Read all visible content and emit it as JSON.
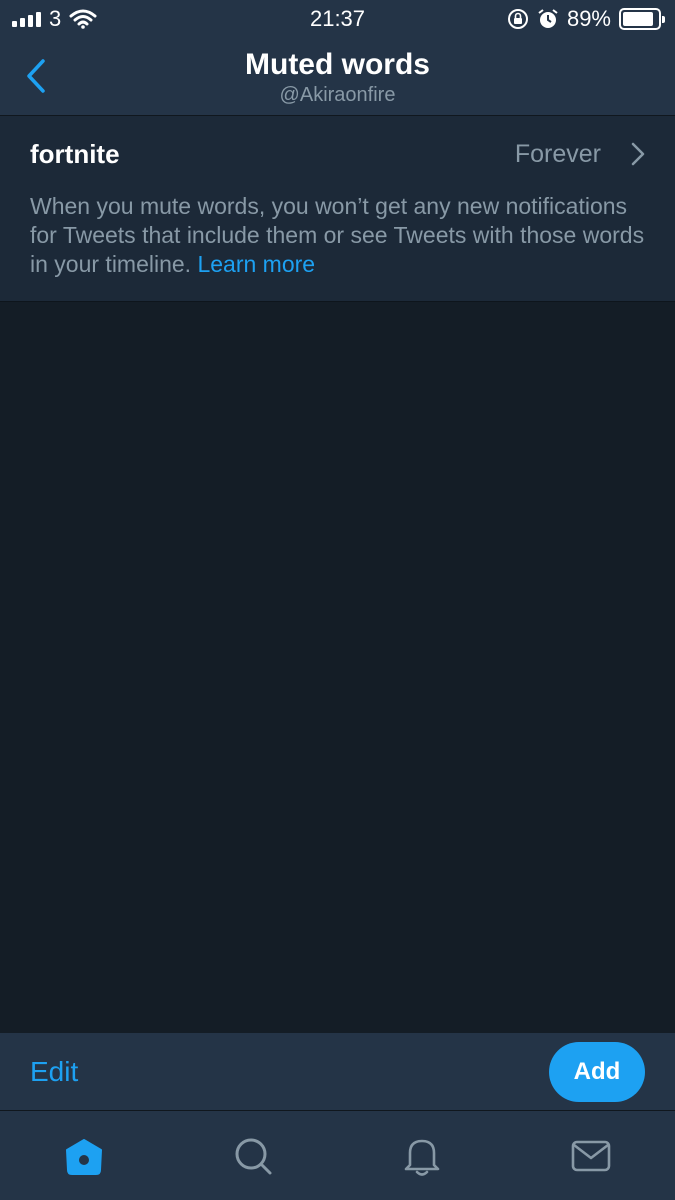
{
  "status_bar": {
    "carrier": "3",
    "time": "21:37",
    "battery": "89%",
    "battery_level": 0.89,
    "icons": [
      "signal-icon",
      "wifi-icon",
      "rotation-lock-icon",
      "alarm-icon",
      "battery-icon"
    ]
  },
  "header": {
    "title": "Muted words",
    "subtitle": "@Akiraonfire",
    "back_icon": "chevron-left-icon"
  },
  "muted_words": [
    {
      "word": "fortnite",
      "duration": "Forever"
    }
  ],
  "info": {
    "text": "When you mute words, you won’t get any new notifications for Tweets that include them or see Tweets with those words in your timeline. ",
    "link": "Learn more"
  },
  "actions": {
    "edit": "Edit",
    "add": "Add"
  },
  "tabs": [
    {
      "name": "home",
      "icon": "home-icon",
      "active": true
    },
    {
      "name": "search",
      "icon": "search-icon",
      "active": false
    },
    {
      "name": "notifications",
      "icon": "bell-icon",
      "active": false
    },
    {
      "name": "messages",
      "icon": "mail-icon",
      "active": false
    }
  ],
  "colors": {
    "accent": "#1da1f2",
    "background": "#141d26",
    "bar": "#243447",
    "row": "#1c2938",
    "secondary_text": "#8899a6"
  }
}
